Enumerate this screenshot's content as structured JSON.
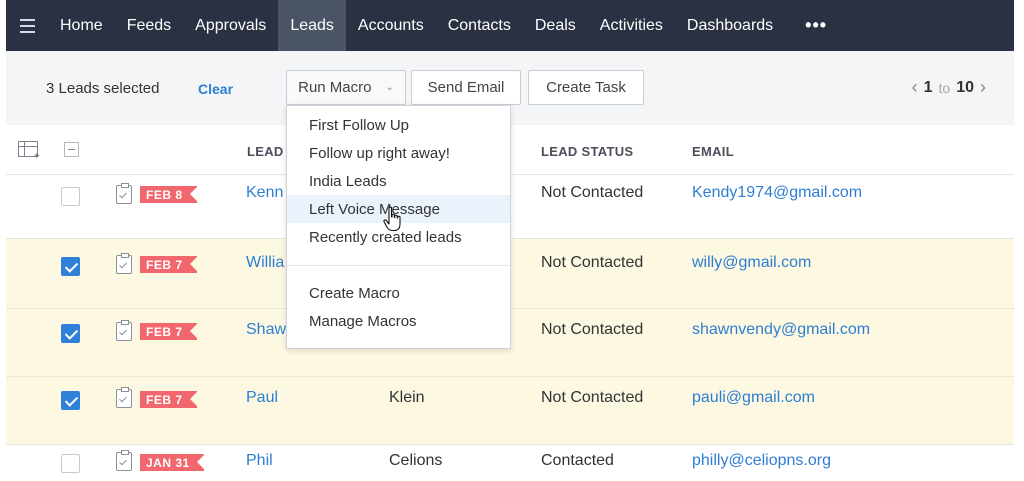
{
  "nav": {
    "items": [
      "Home",
      "Feeds",
      "Approvals",
      "Leads",
      "Accounts",
      "Contacts",
      "Deals",
      "Activities",
      "Dashboards"
    ],
    "active": "Leads",
    "more": "•••"
  },
  "toolbar": {
    "selected_text": "3 Leads selected",
    "clear_label": "Clear",
    "run_macro_label": "Run Macro",
    "send_email_label": "Send Email",
    "create_task_label": "Create Task",
    "pager": {
      "from": "1",
      "to_word": "to",
      "to": "10"
    }
  },
  "table": {
    "headers": {
      "lead": "LEAD",
      "lead_status": "LEAD STATUS",
      "email": "EMAIL"
    },
    "rows": [
      {
        "checked": false,
        "date": "FEB 8",
        "first": "Kenn",
        "last": "",
        "status": "Not Contacted",
        "email": "Kendy1974@gmail.com"
      },
      {
        "checked": true,
        "date": "FEB 7",
        "first": "Willia",
        "last": "",
        "status": "Not Contacted",
        "email": "willy@gmail.com"
      },
      {
        "checked": true,
        "date": "FEB 7",
        "first": "Shaw",
        "last": "",
        "status": "Not Contacted",
        "email": "shawnvendy@gmail.com"
      },
      {
        "checked": true,
        "date": "FEB 7",
        "first": "Paul",
        "last": "Klein",
        "status": "Not Contacted",
        "email": "pauli@gmail.com"
      },
      {
        "checked": false,
        "date": "JAN 31",
        "first": "Phil",
        "last": "Celions",
        "status": "Contacted",
        "email": "philly@celiopns.org"
      }
    ]
  },
  "macro_menu": {
    "items": [
      "First Follow Up",
      "Follow up right away!",
      "India Leads",
      "Left Voice Message",
      "Recently created leads"
    ],
    "actions": [
      "Create Macro",
      "Manage Macros"
    ],
    "hovered": "Left Voice Message"
  },
  "colors": {
    "nav_bg": "#2a3142",
    "nav_active": "#4b5465",
    "link": "#2d7ed3",
    "date_tag": "#f2666e",
    "selected_row": "#fdf8e2",
    "checkbox_on": "#2f80d8"
  }
}
